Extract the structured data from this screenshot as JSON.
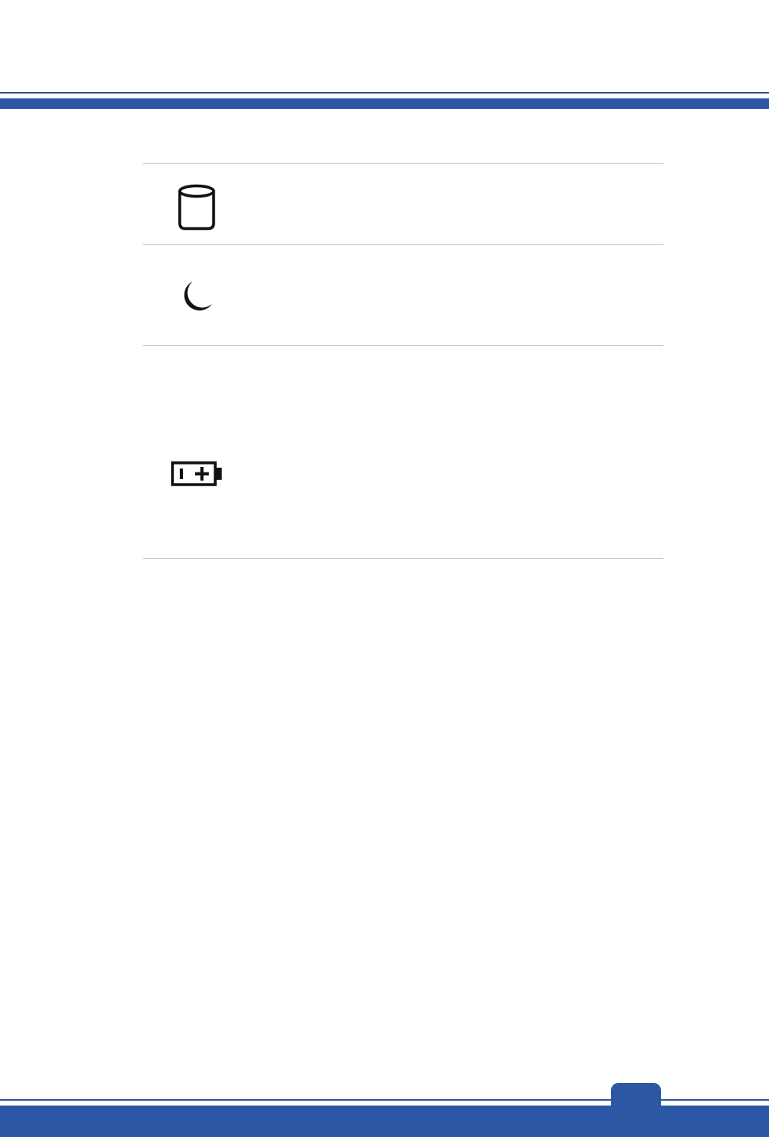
{
  "colors": {
    "accent": "#2B57A5",
    "rule": "#c8c8c8",
    "icon": "#111111"
  },
  "indicators": [
    {
      "icon": "hard-disk-icon"
    },
    {
      "icon": "sleep-moon-icon"
    },
    {
      "icon": "battery-icon"
    }
  ],
  "footer": {
    "page_number": ""
  }
}
